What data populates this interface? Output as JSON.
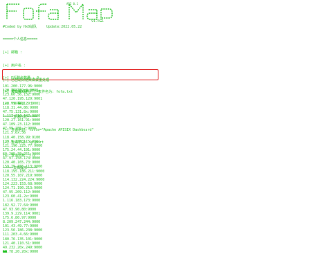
{
  "banner": {
    "title": "FofaMap",
    "api_tag": "API 0.1",
    "version": "v1.0.1"
  },
  "meta": {
    "coded_by": "#Coded by Hx0战队",
    "update": "Update:2022.05.22"
  },
  "header_lines": [
    "=====个人信息=====",
    "[+] 邮箱 :",
    "[+] 用户名 :",
    "[+] F币剩余数量 : 0",
    "[+] 是否是VIP: True",
    "[+] VIP等级 : 1",
    "=====查询内容=====",
    "[+] 查询语句: title=\"Apache APISIX Dashboard\"",
    "[+] 查询字段: ip,port",
    "[+] 查询页数: 1-2",
    "=====文档提示====="
  ],
  "highlight_lines": [
    "[+] 已自动对结果做去重处理",
    "[+] 文档输出路径 : 文件名为: fofa.txt"
  ],
  "ip_list": [
    "101.200.177.96:9000",
    "120.79.182.9:9000",
    "123.60.56.152:9000",
    "47.120.195.129:9001",
    "120.79.31.129:9001",
    "118.31.44.86:9000",
    "47.75.131.8x:9000",
    "1.117.216.147:9000",
    "120.27.161.91:9000",
    "47.109.23.112:9000",
    "47.99.255.2:9000",
    "121.5.6x.56",
    "118.40.158.99:9100",
    "139.9.220.115:9001",
    "121.196.225.77:9000",
    "175.24.44.191:9000",
    "60.205.73.251:9000",
    "47.97.158.174:9000",
    "120.40.165.73:9000",
    "159.75.155.113:9000",
    "118.195.186.211:9000",
    "120.55.107.219:9000",
    "114.132.224.224:9000",
    "124.223.153.68:9000",
    "124.71.190.213:9000",
    "47.95.209.112:9000",
    "123.60.41.2x:9000",
    "1.116.183.173:9000",
    "182.92.77.64:9000",
    "47.93.90.80:9000",
    "139.9.229.114:9001",
    "175.6.80.97:9000",
    "8.209.247.244:9000",
    "101.43.49.77:9000",
    "123.56.186.238:9000",
    "111.203.4.66:9000",
    "180.76.135.101:9000",
    "121.40.110.51:9000",
    "49.232.20x.249:9000",
    "13.78.20.20x:9000"
  ]
}
